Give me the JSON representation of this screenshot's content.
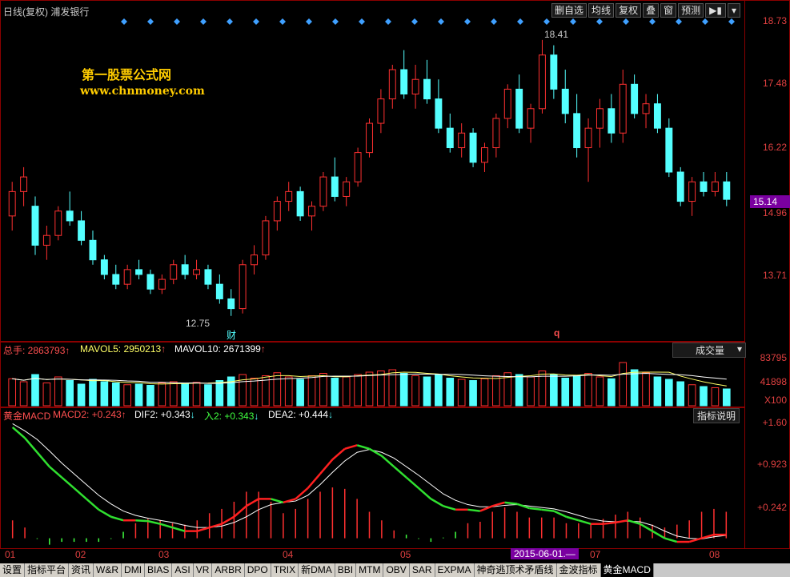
{
  "header": {
    "title": "日线(复权) 浦发银行",
    "toolbar": [
      "删自选",
      "均线",
      "复权",
      "叠",
      "窗",
      "预测"
    ],
    "arrow_icon": "play-arrow-icon"
  },
  "watermark": {
    "line1": "第一股票公式网",
    "line2": "www.chnmoney.com"
  },
  "price_axis": [
    "18.73",
    "17.48",
    "16.22",
    "14.96",
    "13.71"
  ],
  "current_price": "15.14",
  "price_marks": {
    "high": "18.41",
    "low": "12.75"
  },
  "event_marks": {
    "cai": "财",
    "q": "q"
  },
  "volume_panel": {
    "total_label": "总手: 2863793",
    "mavol5": "MAVOL5: 2950213",
    "mavol10": "MAVOL10: 2671399",
    "selector": "成交量",
    "axis": [
      "83795",
      "41898",
      "X100"
    ]
  },
  "macd_panel": {
    "name": "黄金MACD",
    "macd2": "MACD2: +0.243",
    "dif2": "DIF2: +0.343",
    "in2": "入2: +0.343",
    "dea2": "DEA2: +0.444",
    "help_button": "指标说明",
    "axis": [
      "+1.60",
      "+0.923",
      "+0.242"
    ]
  },
  "time_axis": {
    "months": [
      "01",
      "02",
      "03",
      "04",
      "05",
      "07",
      "08"
    ],
    "cursor_date": "2015-06-01.—"
  },
  "tabs": [
    "设置",
    "指标平台",
    "资讯",
    "W&R",
    "DMI",
    "BIAS",
    "ASI",
    "VR",
    "ARBR",
    "DPO",
    "TRIX",
    "新DMA",
    "BBI",
    "MTM",
    "OBV",
    "SAR",
    "EXPMA",
    "神奇逃顶术矛盾线",
    "金波指标",
    "黄金MACD"
  ],
  "colors": {
    "up": "#ff3030",
    "down": "#54ffff",
    "axis": "#e04040",
    "frame": "#8b0000",
    "accent": "#7a00a0"
  },
  "chart_data": {
    "type": "candlestick",
    "ylim": [
      12.5,
      18.9
    ],
    "candles": [
      [
        14.8,
        15.5,
        14.5,
        15.3
      ],
      [
        15.3,
        15.8,
        15.0,
        15.6
      ],
      [
        15.0,
        15.2,
        14.0,
        14.2
      ],
      [
        14.2,
        14.6,
        13.9,
        14.4
      ],
      [
        14.4,
        15.0,
        14.3,
        14.9
      ],
      [
        14.9,
        15.3,
        14.6,
        14.7
      ],
      [
        14.7,
        14.9,
        14.2,
        14.3
      ],
      [
        14.3,
        14.5,
        13.8,
        13.9
      ],
      [
        13.9,
        14.0,
        13.5,
        13.6
      ],
      [
        13.6,
        13.8,
        13.3,
        13.4
      ],
      [
        13.4,
        13.8,
        13.3,
        13.7
      ],
      [
        13.7,
        13.9,
        13.5,
        13.6
      ],
      [
        13.6,
        13.7,
        13.2,
        13.3
      ],
      [
        13.3,
        13.6,
        13.2,
        13.5
      ],
      [
        13.5,
        13.9,
        13.4,
        13.8
      ],
      [
        13.8,
        14.0,
        13.5,
        13.6
      ],
      [
        13.6,
        13.9,
        13.5,
        13.7
      ],
      [
        13.7,
        13.8,
        13.3,
        13.4
      ],
      [
        13.4,
        13.6,
        13.0,
        13.1
      ],
      [
        13.1,
        13.3,
        12.75,
        12.9
      ],
      [
        12.9,
        13.9,
        12.8,
        13.8
      ],
      [
        13.8,
        14.2,
        13.6,
        14.0
      ],
      [
        14.0,
        14.8,
        13.9,
        14.7
      ],
      [
        14.7,
        15.2,
        14.5,
        15.1
      ],
      [
        15.1,
        15.5,
        14.9,
        15.3
      ],
      [
        15.3,
        15.4,
        14.7,
        14.8
      ],
      [
        14.8,
        15.1,
        14.5,
        15.0
      ],
      [
        15.0,
        15.7,
        14.9,
        15.6
      ],
      [
        15.6,
        16.0,
        15.1,
        15.2
      ],
      [
        15.2,
        15.6,
        15.0,
        15.5
      ],
      [
        15.5,
        16.2,
        15.4,
        16.1
      ],
      [
        16.1,
        16.8,
        16.0,
        16.7
      ],
      [
        16.7,
        17.4,
        16.5,
        17.2
      ],
      [
        17.2,
        17.9,
        17.0,
        17.8
      ],
      [
        17.8,
        18.2,
        17.2,
        17.3
      ],
      [
        17.3,
        17.9,
        17.0,
        17.6
      ],
      [
        17.6,
        18.0,
        17.1,
        17.2
      ],
      [
        17.2,
        17.6,
        16.5,
        16.6
      ],
      [
        16.6,
        16.9,
        16.1,
        16.2
      ],
      [
        16.2,
        16.7,
        16.0,
        16.5
      ],
      [
        16.5,
        16.6,
        15.8,
        15.9
      ],
      [
        15.9,
        16.3,
        15.7,
        16.2
      ],
      [
        16.2,
        16.9,
        16.0,
        16.8
      ],
      [
        16.8,
        17.5,
        16.6,
        17.4
      ],
      [
        17.4,
        17.7,
        16.5,
        16.6
      ],
      [
        16.6,
        17.1,
        16.3,
        17.0
      ],
      [
        17.0,
        18.41,
        16.9,
        18.1
      ],
      [
        18.1,
        18.3,
        17.2,
        17.4
      ],
      [
        17.4,
        17.8,
        16.7,
        16.9
      ],
      [
        16.9,
        17.3,
        16.0,
        16.2
      ],
      [
        16.2,
        16.8,
        15.5,
        16.6
      ],
      [
        16.6,
        17.2,
        16.2,
        17.0
      ],
      [
        17.0,
        17.3,
        16.3,
        16.5
      ],
      [
        16.5,
        17.8,
        16.3,
        17.5
      ],
      [
        17.5,
        17.7,
        16.8,
        16.9
      ],
      [
        16.9,
        17.3,
        16.6,
        17.1
      ],
      [
        17.1,
        17.3,
        16.5,
        16.6
      ],
      [
        16.6,
        16.8,
        15.6,
        15.7
      ],
      [
        15.7,
        15.8,
        15.0,
        15.1
      ],
      [
        15.1,
        15.6,
        14.8,
        15.5
      ],
      [
        15.5,
        15.7,
        15.2,
        15.3
      ],
      [
        15.3,
        15.7,
        15.2,
        15.5
      ],
      [
        15.5,
        15.7,
        15.0,
        15.14
      ]
    ],
    "volume": [
      45,
      40,
      52,
      38,
      48,
      42,
      36,
      44,
      40,
      38,
      35,
      36,
      34,
      38,
      40,
      37,
      39,
      35,
      42,
      48,
      52,
      46,
      50,
      55,
      48,
      44,
      50,
      54,
      46,
      48,
      52,
      56,
      58,
      60,
      54,
      50,
      48,
      52,
      46,
      44,
      42,
      45,
      50,
      55,
      52,
      48,
      58,
      52,
      46,
      50,
      54,
      48,
      45,
      72,
      60,
      55,
      48,
      44,
      40,
      35,
      32,
      30,
      28
    ],
    "dif": [
      1.55,
      1.4,
      1.2,
      1.0,
      0.85,
      0.7,
      0.55,
      0.4,
      0.3,
      0.25,
      0.25,
      0.24,
      0.2,
      0.15,
      0.1,
      0.1,
      0.15,
      0.2,
      0.3,
      0.45,
      0.55,
      0.55,
      0.5,
      0.55,
      0.7,
      0.9,
      1.1,
      1.25,
      1.3,
      1.25,
      1.15,
      1.0,
      0.85,
      0.7,
      0.55,
      0.45,
      0.4,
      0.4,
      0.38,
      0.45,
      0.5,
      0.48,
      0.42,
      0.4,
      0.38,
      0.3,
      0.25,
      0.2,
      0.2,
      0.22,
      0.25,
      0.2,
      0.1,
      0.0,
      -0.05,
      -0.05,
      0.0,
      0.05,
      0.05
    ],
    "dea": [
      1.6,
      1.5,
      1.38,
      1.22,
      1.05,
      0.9,
      0.75,
      0.6,
      0.48,
      0.38,
      0.32,
      0.28,
      0.25,
      0.22,
      0.18,
      0.15,
      0.15,
      0.17,
      0.22,
      0.3,
      0.4,
      0.47,
      0.5,
      0.52,
      0.6,
      0.75,
      0.92,
      1.08,
      1.2,
      1.24,
      1.2,
      1.12,
      1.0,
      0.88,
      0.75,
      0.62,
      0.53,
      0.47,
      0.44,
      0.44,
      0.46,
      0.47,
      0.45,
      0.43,
      0.41,
      0.37,
      0.32,
      0.27,
      0.24,
      0.23,
      0.24,
      0.23,
      0.18,
      0.1,
      0.03,
      0.0,
      -0.01,
      0.02,
      0.04
    ]
  }
}
